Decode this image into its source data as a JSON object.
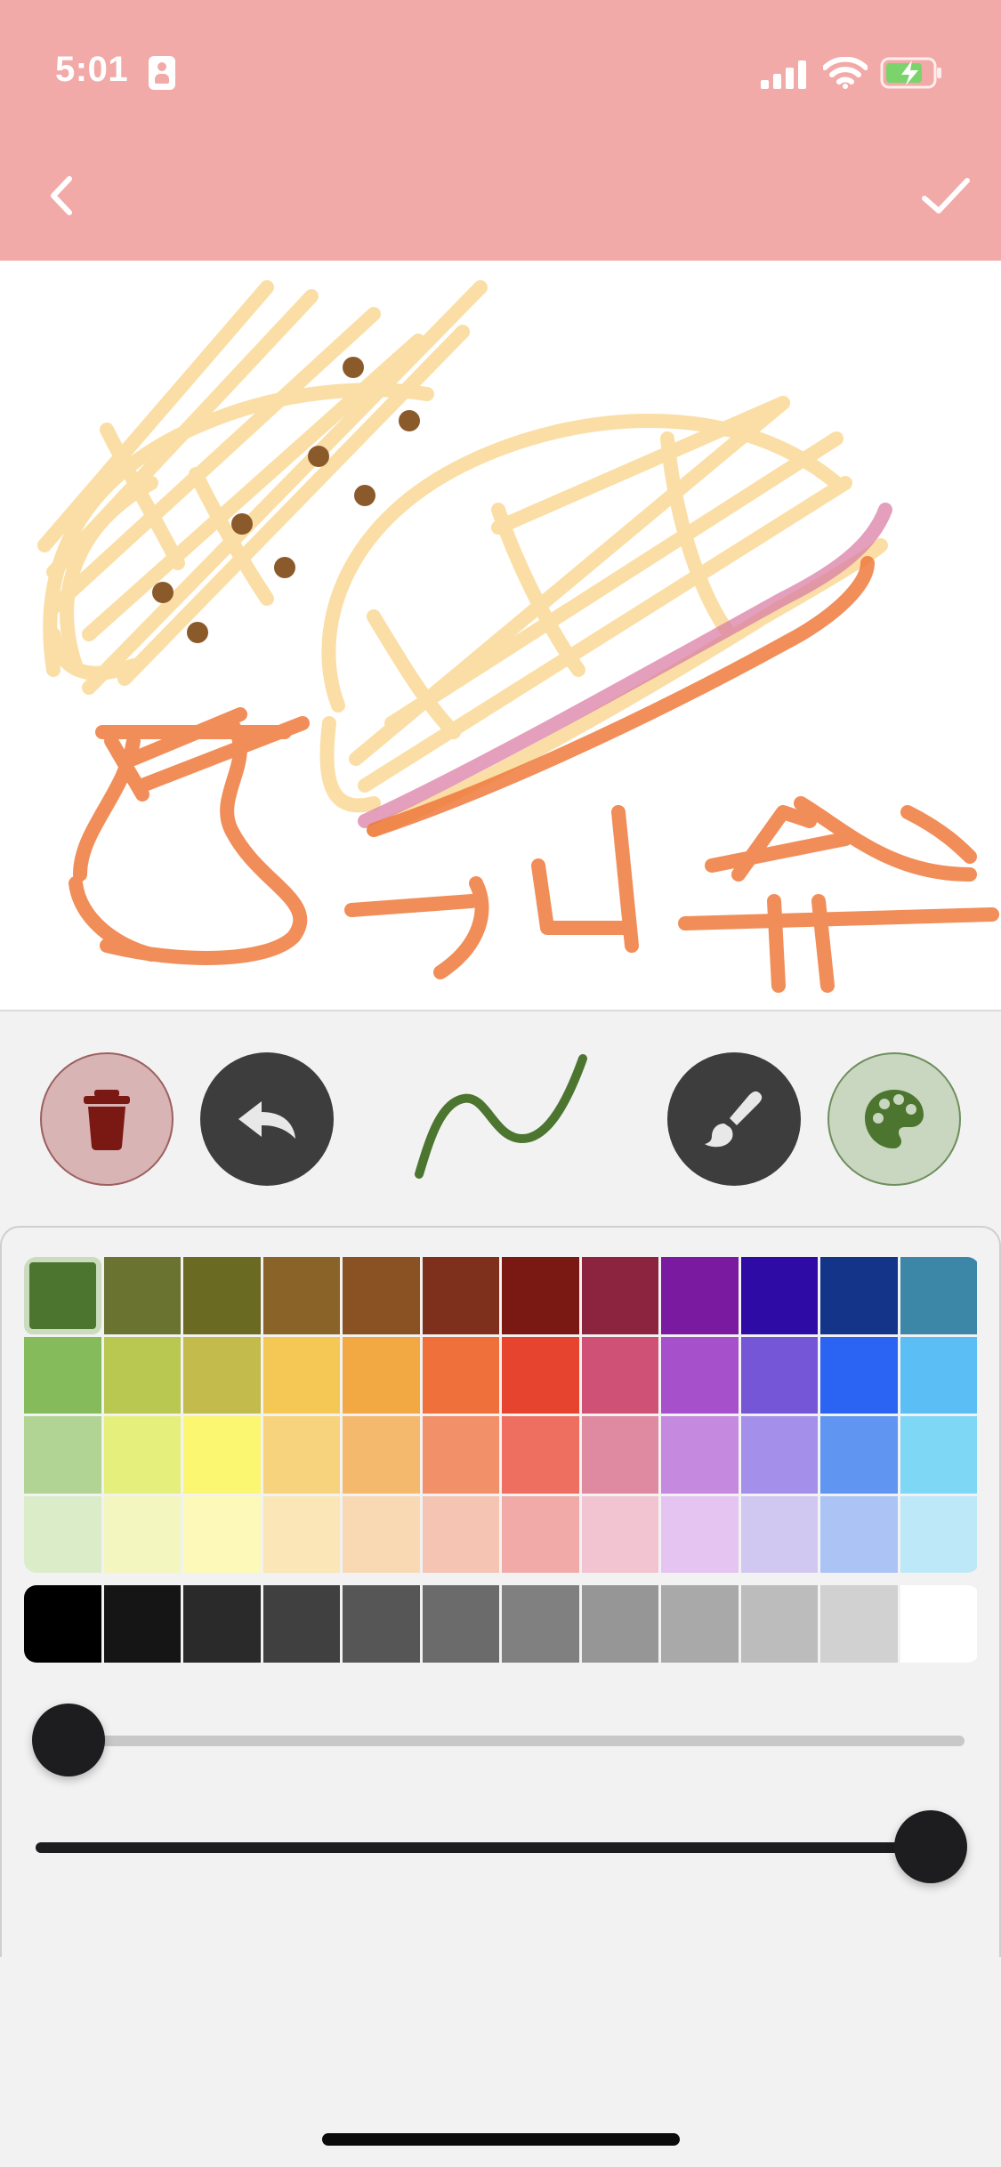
{
  "status_bar": {
    "time": "5:01"
  },
  "header": {
    "back_icon": "chevron-left-icon",
    "confirm_icon": "checkmark-icon"
  },
  "toolbar": {
    "delete_icon": "trash-icon",
    "undo_icon": "undo-icon",
    "stroke_preview_icon": "stroke-preview",
    "brush_icon": "brush-icon",
    "palette_icon": "palette-icon",
    "current_color": "#4c7530"
  },
  "palette": {
    "selected": "#4c7530",
    "rows": [
      [
        "#4c7530",
        "#6b7330",
        "#6a6a23",
        "#8a6328",
        "#8a5223",
        "#7e301c",
        "#7a1814",
        "#8c2440",
        "#7a1aa0",
        "#2f0ba6",
        "#14348a",
        "#3c87a8"
      ],
      [
        "#86bb5c",
        "#b8c850",
        "#c3bb4c",
        "#f5c855",
        "#f2a843",
        "#f0703b",
        "#e6442e",
        "#cf5276",
        "#a650cb",
        "#7556d6",
        "#2b63f2",
        "#5bbff5"
      ],
      [
        "#b1d494",
        "#e5ef7c",
        "#fcf771",
        "#f7d37e",
        "#f5b96e",
        "#f2906a",
        "#ee6e5f",
        "#e08aa2",
        "#c589e0",
        "#a490ea",
        "#6096f2",
        "#7ed7f5"
      ],
      [
        "#daecc8",
        "#f4f6c0",
        "#fdf9b8",
        "#fae6b6",
        "#f8d9b4",
        "#f5c4b3",
        "#f2aaa8",
        "#f2c4d2",
        "#e6c4f2",
        "#d1c8f2",
        "#abc4f5",
        "#bce8f8"
      ]
    ],
    "grays": [
      "#000000",
      "#151515",
      "#2a2a2a",
      "#404040",
      "#565656",
      "#6b6b6b",
      "#808080",
      "#969696",
      "#a9a9a9",
      "#bcbcbc",
      "#d1d1d1",
      "#ffffff"
    ]
  },
  "sliders": {
    "opacity_level": 0.0,
    "size_level": 1.0
  }
}
